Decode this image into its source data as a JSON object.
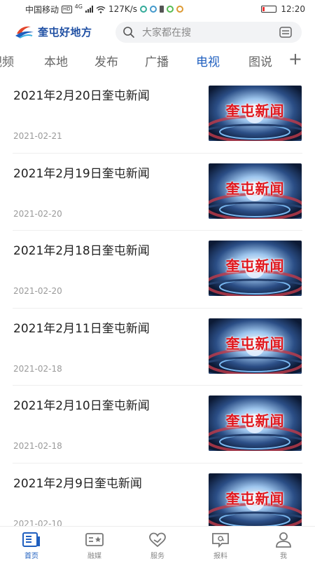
{
  "status_bar": {
    "carrier": "中国移动",
    "hd": "HD",
    "network": "4G",
    "speed": "127K/s",
    "time": "12:20"
  },
  "header": {
    "logo_text": "奎屯好地方",
    "search_placeholder": "大家都在搜"
  },
  "tabs": [
    {
      "label": "视频",
      "active": false
    },
    {
      "label": "本地",
      "active": false
    },
    {
      "label": "发布",
      "active": false
    },
    {
      "label": "广播",
      "active": false
    },
    {
      "label": "电视",
      "active": true
    },
    {
      "label": "图说",
      "active": false
    }
  ],
  "tabs_add": "+",
  "news": [
    {
      "title": "2021年2月20日奎屯新闻",
      "date": "2021-02-21",
      "thumb_text": "奎屯新闻"
    },
    {
      "title": "2021年2月19日奎屯新闻",
      "date": "2021-02-20",
      "thumb_text": "奎屯新闻"
    },
    {
      "title": "2021年2月18日奎屯新闻",
      "date": "2021-02-20",
      "thumb_text": "奎屯新闻"
    },
    {
      "title": "2021年2月11日奎屯新闻",
      "date": "2021-02-18",
      "thumb_text": "奎屯新闻"
    },
    {
      "title": "2021年2月10日奎屯新闻",
      "date": "2021-02-18",
      "thumb_text": "奎屯新闻"
    },
    {
      "title": "2021年2月9日奎屯新闻",
      "date": "2021-02-10",
      "thumb_text": "奎屯新闻"
    }
  ],
  "bottom_nav": [
    {
      "label": "首页",
      "icon": "home-icon",
      "active": true
    },
    {
      "label": "融媒",
      "icon": "media-icon",
      "active": false
    },
    {
      "label": "服务",
      "icon": "service-icon",
      "active": false
    },
    {
      "label": "报料",
      "icon": "report-icon",
      "active": false
    },
    {
      "label": "我",
      "icon": "user-icon",
      "active": false
    }
  ],
  "colors": {
    "accent": "#1f5fbf",
    "thumb_text": "#e0161c"
  }
}
